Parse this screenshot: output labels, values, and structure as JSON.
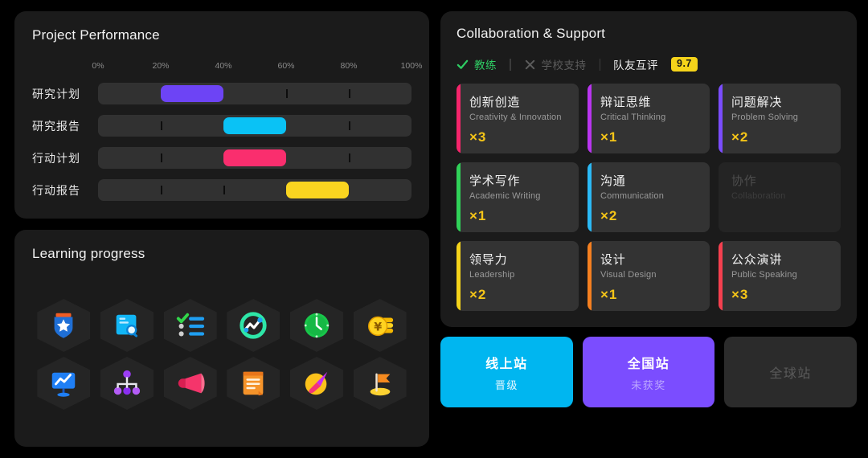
{
  "performance": {
    "title": "Project Performance",
    "axis_labels": [
      "0%",
      "20%",
      "40%",
      "60%",
      "80%",
      "100%"
    ],
    "axis_positions": [
      0,
      20,
      40,
      60,
      80,
      100
    ],
    "rows": [
      {
        "label": "研究计划",
        "start": 20,
        "end": 40,
        "color": "#6d44f5",
        "ticks": [
          60,
          80
        ]
      },
      {
        "label": "研究报告",
        "start": 40,
        "end": 60,
        "color": "#0ac2f5",
        "ticks": [
          20,
          80
        ]
      },
      {
        "label": "行动计划",
        "start": 40,
        "end": 60,
        "color": "#fa2e6e",
        "ticks": [
          20,
          80
        ]
      },
      {
        "label": "行动报告",
        "start": 60,
        "end": 80,
        "color": "#fad520",
        "ticks": [
          20,
          40
        ]
      }
    ]
  },
  "learning": {
    "title": "Learning progress",
    "badges": [
      {
        "icon": "shield-star-icon"
      },
      {
        "icon": "document-search-icon"
      },
      {
        "icon": "checklist-icon"
      },
      {
        "icon": "analytics-chart-icon"
      },
      {
        "icon": "clock-icon"
      },
      {
        "icon": "coins-yen-icon"
      },
      {
        "icon": "presentation-chart-icon"
      },
      {
        "icon": "org-network-icon"
      },
      {
        "icon": "megaphone-icon"
      },
      {
        "icon": "notes-icon"
      },
      {
        "icon": "rocket-comet-icon"
      },
      {
        "icon": "flag-goal-icon"
      }
    ]
  },
  "collaboration": {
    "title": "Collaboration & Support",
    "status": [
      {
        "icon": "check-icon",
        "label": "教练",
        "state": "on"
      },
      {
        "icon": "cross-icon",
        "label": "学校支持",
        "state": "off"
      },
      {
        "icon": "none",
        "label": "队友互评",
        "state": "plain",
        "score": "9.7"
      }
    ],
    "skills": [
      {
        "cn": "创新创造",
        "en": "Creativity & Innovation",
        "count": "×3",
        "accent": "#f5256b",
        "enabled": true
      },
      {
        "cn": "辩证思维",
        "en": "Critical Thinking",
        "count": "×1",
        "accent": "#b935f0",
        "enabled": true
      },
      {
        "cn": "问题解决",
        "en": "Problem Solving",
        "count": "×2",
        "accent": "#7b4dff",
        "enabled": true
      },
      {
        "cn": "学术写作",
        "en": "Academic Writing",
        "count": "×1",
        "accent": "#30d158",
        "enabled": true
      },
      {
        "cn": "沟通",
        "en": "Communication",
        "count": "×2",
        "accent": "#2bb9f5",
        "enabled": true
      },
      {
        "cn": "协作",
        "en": "Collaboration",
        "count": "",
        "accent": "",
        "enabled": false
      },
      {
        "cn": "领导力",
        "en": "Leadership",
        "count": "×2",
        "accent": "#f5d31a",
        "enabled": true
      },
      {
        "cn": "设计",
        "en": "Visual Design",
        "count": "×1",
        "accent": "#f58020",
        "enabled": true
      },
      {
        "cn": "公众演讲",
        "en": "Public Speaking",
        "count": "×3",
        "accent": "#f5404f",
        "enabled": true
      }
    ]
  },
  "stages": [
    {
      "title": "线上站",
      "sub": "晋级",
      "style": "cyan"
    },
    {
      "title": "全国站",
      "sub": "未获奖",
      "style": "purple"
    },
    {
      "title": "全球站",
      "sub": "",
      "style": "grey"
    }
  ]
}
